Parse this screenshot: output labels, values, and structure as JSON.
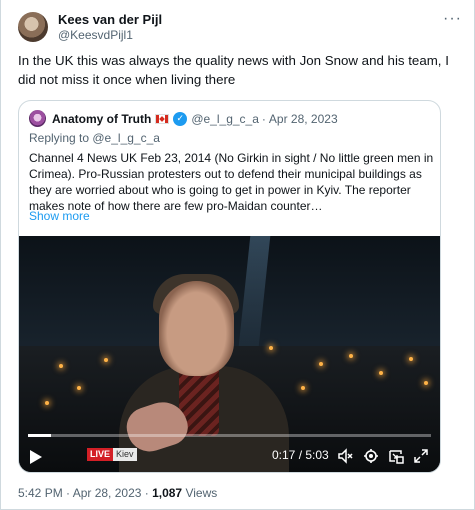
{
  "author": {
    "display_name": "Kees van der Pijl",
    "handle": "@KeesvdPijl1"
  },
  "tweet_text": "In the UK this was always the quality news with Jon Snow and his team, I did not miss it once when living there",
  "quote": {
    "display_name": "Anatomy of Truth",
    "flag": "canada-flag-icon",
    "verified": "verified-badge-icon",
    "handle": "@e_l_g_c_a",
    "separator": "·",
    "date": "Apr 28, 2023",
    "replying_to": "Replying to @e_l_g_c_a",
    "text": "Channel 4 News UK Feb 23, 2014 (No Girkin in sight / No little green men in Crimea).  Pro-Russian protesters out to defend their municipal buildings as they are worried about who is going to get in power in Kyiv. The reporter makes note of how there are few pro-Maidan counter…",
    "show_more": "Show more"
  },
  "video": {
    "live_label": "LIVE",
    "location_label": "Kiev",
    "elapsed": "0:17",
    "duration": "5:03",
    "time_display": "0:17 / 5:03",
    "progress": 0.056
  },
  "footer": {
    "timestamp": "5:42 PM · Apr 28, 2023 · ",
    "views_count": "1,087",
    "views_label": " Views"
  },
  "more_label": "···"
}
